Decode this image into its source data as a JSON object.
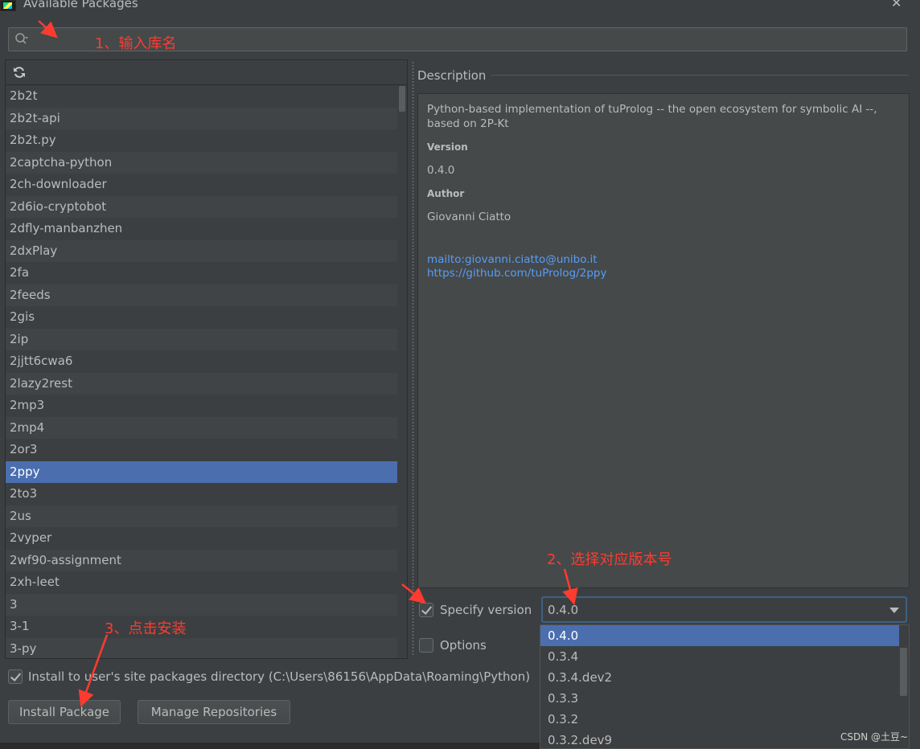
{
  "window": {
    "title": "Available Packages",
    "close_glyph": "✕"
  },
  "search": {
    "value": "",
    "placeholder": ""
  },
  "packages": {
    "items": [
      "2b2t",
      "2b2t-api",
      "2b2t.py",
      "2captcha-python",
      "2ch-downloader",
      "2d6io-cryptobot",
      "2dfly-manbanzhen",
      "2dxPlay",
      "2fa",
      "2feeds",
      "2gis",
      "2ip",
      "2jjtt6cwa6",
      "2lazy2rest",
      "2mp3",
      "2mp4",
      "2or3",
      "2ppy",
      "2to3",
      "2us",
      "2vyper",
      "2wf90-assignment",
      "2xh-leet",
      "3",
      "3-1",
      "3-py"
    ],
    "selected": "2ppy"
  },
  "description": {
    "label": "Description",
    "text": "Python-based implementation of tuProlog -- the open ecosystem for symbolic AI --, based on 2P-Kt",
    "version_heading": "Version",
    "version_value": "0.4.0",
    "author_heading": "Author",
    "author_value": "Giovanni Ciatto",
    "email_link": "mailto:giovanni.ciatto@unibo.it",
    "url_link": "https://github.com/tuProlog/2ppy"
  },
  "version_control": {
    "specify_label": "Specify version",
    "specify_checked": true,
    "selected_version": "0.4.0",
    "options": [
      "0.4.0",
      "0.3.4",
      "0.3.4.dev2",
      "0.3.3",
      "0.3.2",
      "0.3.2.dev9"
    ],
    "options_label": "Options",
    "options_checked": false
  },
  "install_user": {
    "label": "Install to user's site packages directory (C:\\Users\\86156\\AppData\\Roaming\\Python)",
    "checked": true
  },
  "buttons": {
    "install": "Install Package",
    "manage": "Manage Repositories"
  },
  "annotations": {
    "step1": "1、输入库名",
    "step2": "2、选择对应版本号",
    "step3": "3、点击安装"
  },
  "watermark": "CSDN @土豆~",
  "colors": {
    "selection": "#4b6eaf",
    "background": "#3c3f41",
    "link": "#589df6",
    "annotation": "#ff3b30"
  }
}
